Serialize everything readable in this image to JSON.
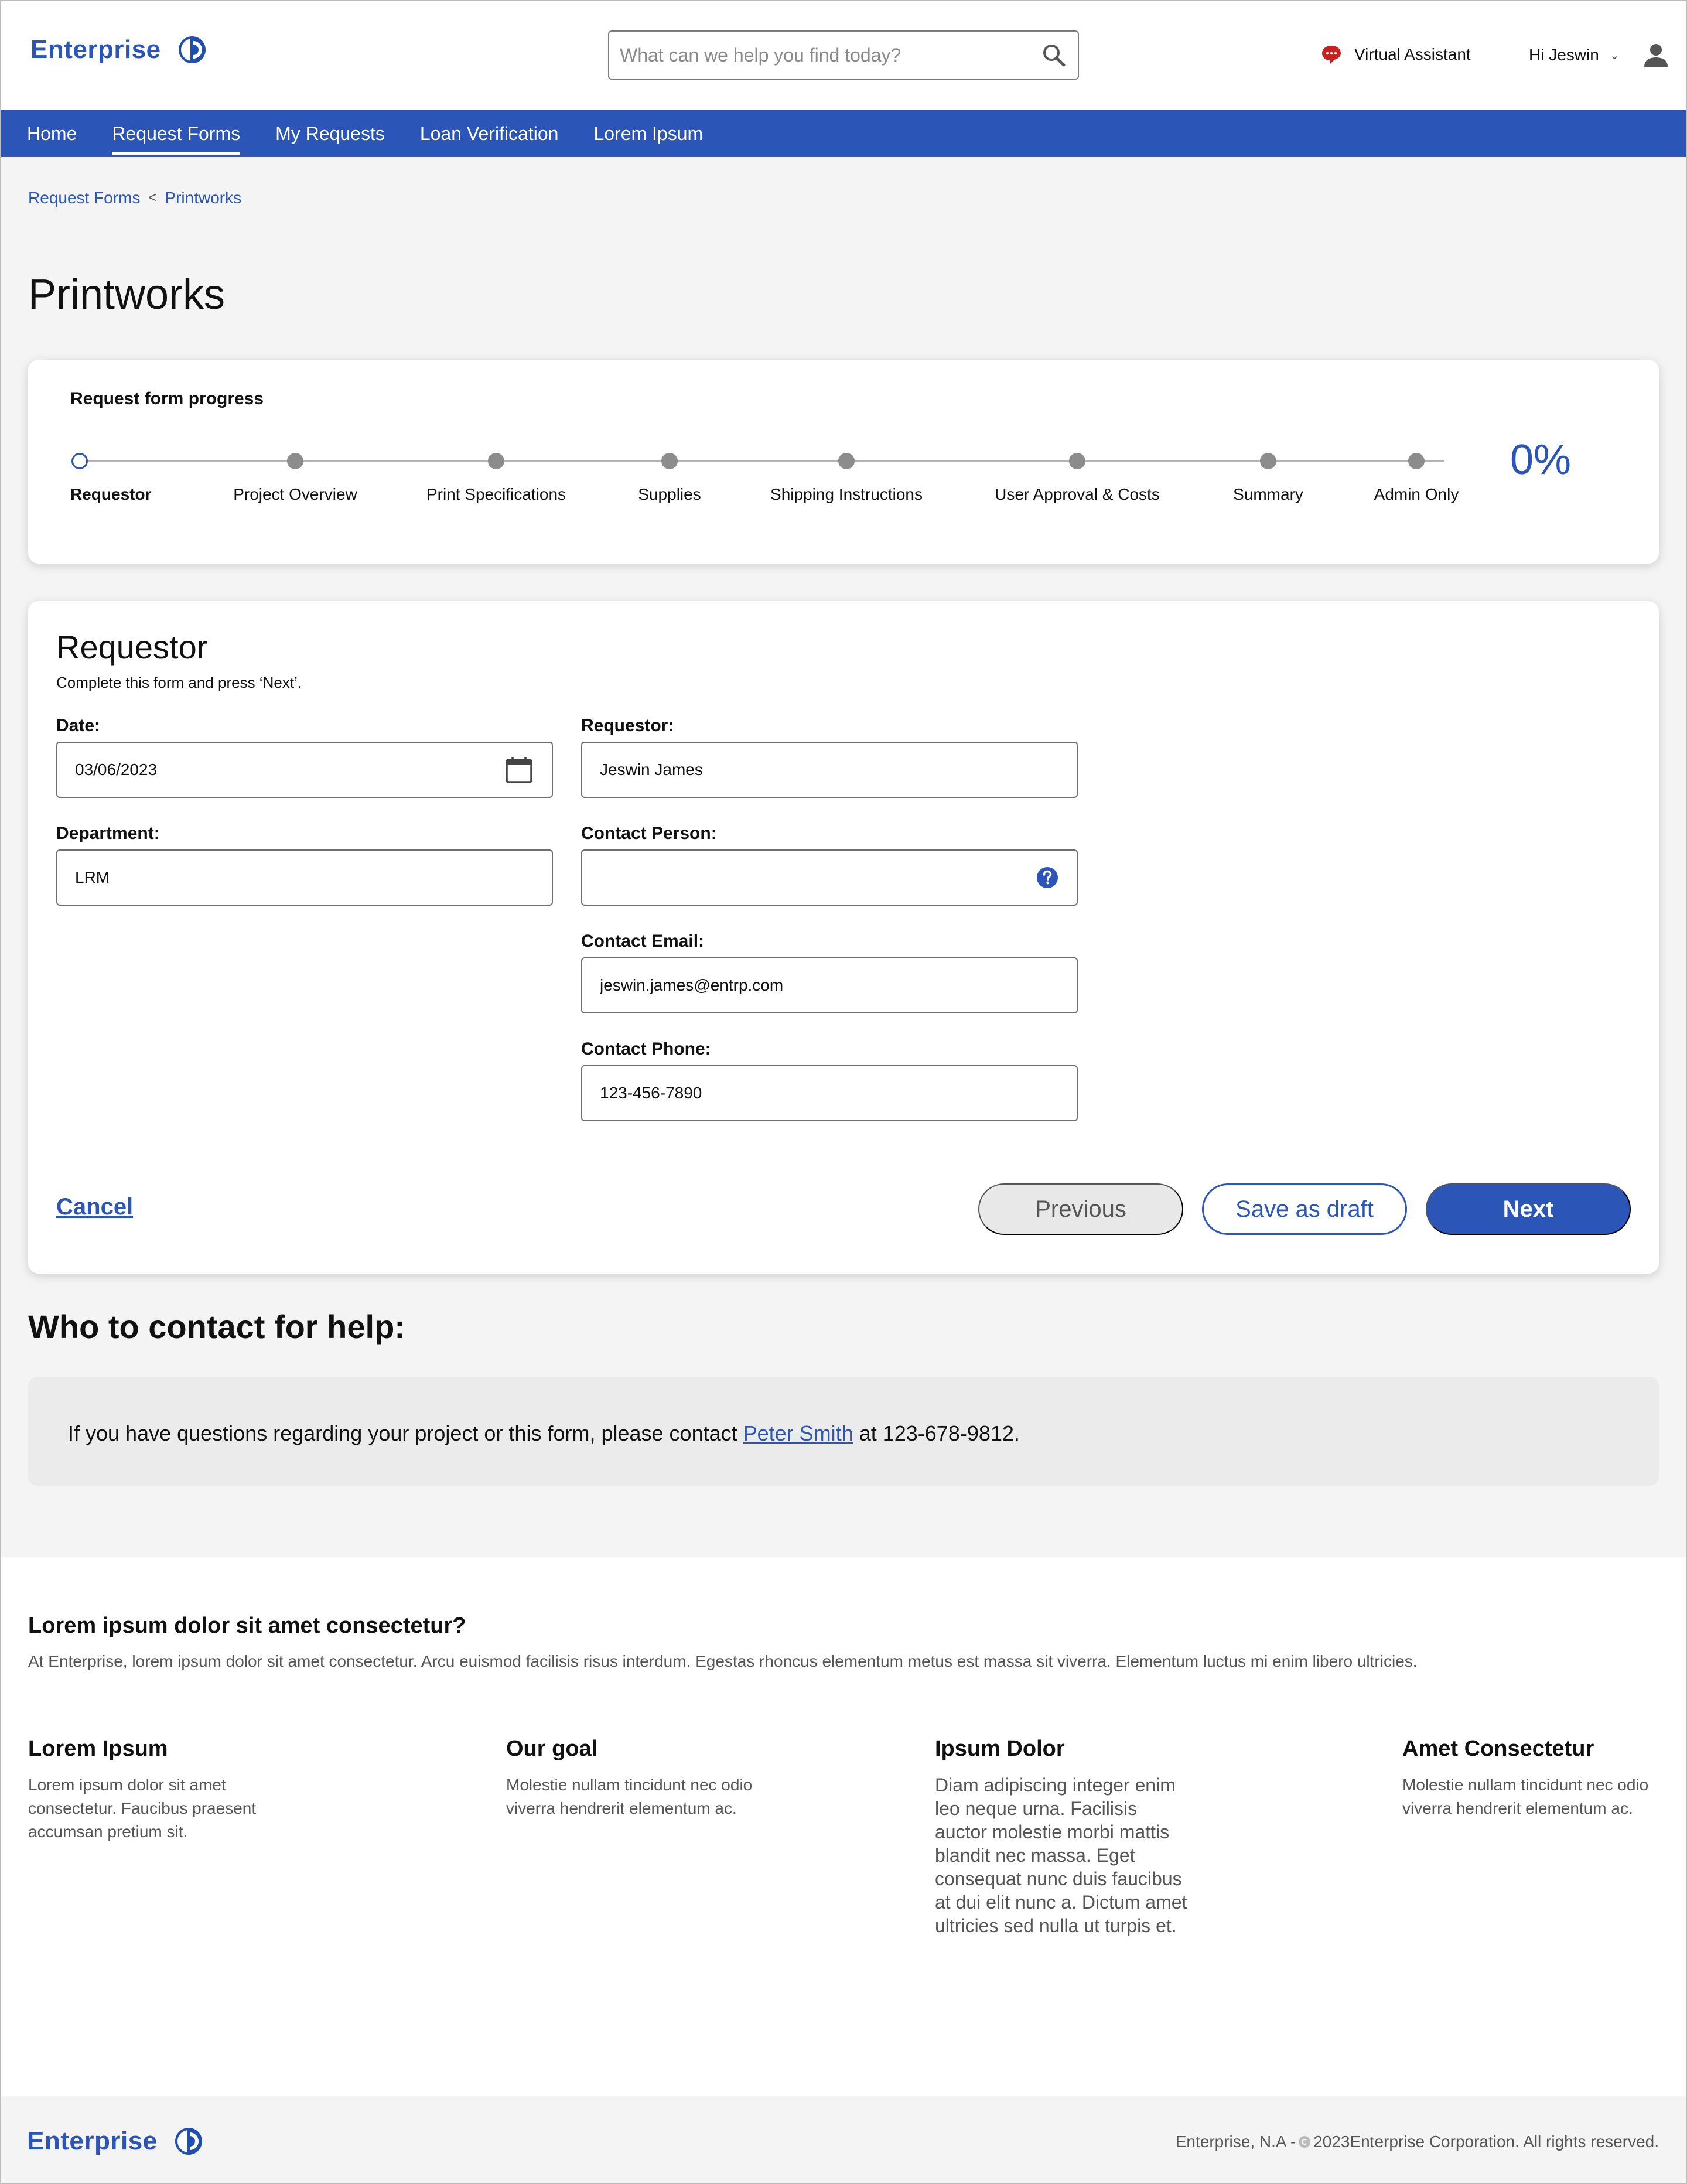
{
  "header": {
    "brand": "Enterprise",
    "search_placeholder": "What can we help you find today?",
    "virtual_assistant": "Virtual Assistant",
    "greeting": "Hi Jeswin",
    "caret": "⌄"
  },
  "nav": {
    "items": [
      "Home",
      "Request Forms",
      "My Requests",
      "Loan Verification",
      "Lorem Ipsum"
    ],
    "active": "Request Forms"
  },
  "breadcrumb": {
    "parent": "Request Forms",
    "separator": "<",
    "current": "Printworks"
  },
  "page_title": "Printworks",
  "progress": {
    "title": "Request form progress",
    "steps": [
      "Requestor",
      "Project Overview",
      "Print Specifications",
      "Supplies",
      "Shipping Instructions",
      "User Approval & Costs",
      "Summary",
      "Admin Only"
    ],
    "current_step": 0,
    "percent": "0%"
  },
  "form": {
    "title": "Requestor",
    "subtitle": "Complete this form and press ‘Next’.",
    "fields": {
      "date": {
        "label": "Date:",
        "value": "03/06/2023"
      },
      "department": {
        "label": "Department:",
        "value": "LRM"
      },
      "requestor": {
        "label": "Requestor:",
        "value": "Jeswin James"
      },
      "contact_person": {
        "label": "Contact Person:",
        "value": ""
      },
      "contact_email": {
        "label": "Contact Email:",
        "value": "jeswin.james@entrp.com"
      },
      "contact_phone": {
        "label": "Contact Phone:",
        "value": "123-456-7890"
      }
    },
    "cancel": "Cancel",
    "previous": "Previous",
    "save_draft": "Save as draft",
    "next": "Next"
  },
  "help": {
    "title": "Who to contact for help:",
    "text_before": "If you have questions regarding your project or this form, please contact ",
    "contact_name": "Peter Smith",
    "text_after": " at 123-678-9812."
  },
  "footer": {
    "question": "Lorem ipsum dolor sit amet consectetur?",
    "description": "At Enterprise, lorem ipsum dolor sit amet consectetur. Arcu euismod facilisis risus interdum. Egestas rhoncus elementum metus est massa sit viverra. Elementum luctus mi enim libero ultricies.",
    "columns": [
      {
        "title": "Lorem Ipsum",
        "text": "Lorem ipsum dolor sit amet\nconsectetur. Faucibus praesent\naccumsan pretium sit."
      },
      {
        "title": "Our goal",
        "text": "Molestie nullam tincidunt nec odio\nviverra hendrerit elementum ac."
      },
      {
        "title": "Ipsum Dolor",
        "text": "Diam adipiscing integer enim\nleo neque urna. Facilisis\nauctor molestie morbi mattis\nblandit nec massa. Eget\nconsequat nunc duis faucibus\nat dui elit nunc a. Dictum amet\nultricies sed nulla ut turpis et."
      },
      {
        "title": "Amet Consectetur",
        "text": "Molestie nullam tincidunt nec odio\nviverra hendrerit elementum ac."
      }
    ],
    "brand": "Enterprise",
    "copyright_prefix": "Enterprise, N.A -",
    "copyright_suffix": "2023Enterprise Corporation. All rights reserved."
  },
  "colors": {
    "brand_blue": "#2b56b8",
    "assistant_red": "#c8201e",
    "step_grey": "#8c8c8c"
  },
  "icons": [
    "logo-mark-icon",
    "search-icon",
    "chat-bubble-icon",
    "user-icon",
    "calendar-icon",
    "help-circle-icon",
    "copyright-icon"
  ]
}
